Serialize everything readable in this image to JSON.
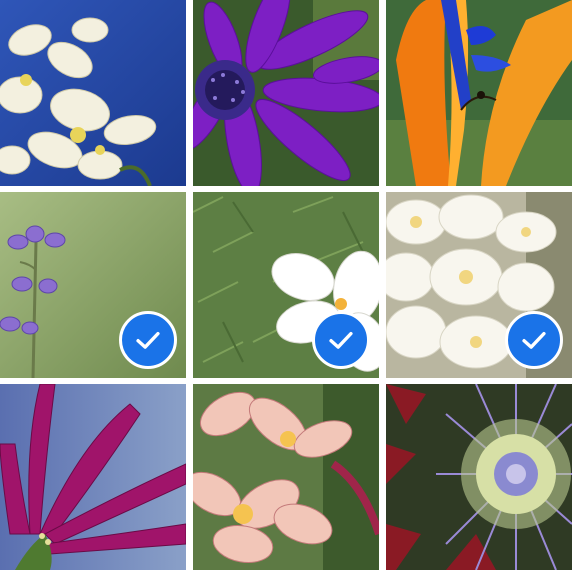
{
  "grid": {
    "photos": [
      {
        "id": "plumeria-white-blue-sky",
        "selected": false
      },
      {
        "id": "purple-daisy",
        "selected": false
      },
      {
        "id": "bird-of-paradise",
        "selected": false
      },
      {
        "id": "purple-lupine",
        "selected": true
      },
      {
        "id": "white-flower-on-grass",
        "selected": true
      },
      {
        "id": "white-plumeria-cluster",
        "selected": true
      },
      {
        "id": "magenta-petals",
        "selected": false
      },
      {
        "id": "pink-yellow-plumeria",
        "selected": false
      },
      {
        "id": "protea-flower",
        "selected": false
      }
    ]
  },
  "icons": {
    "selected_badge": "checkmark-circle-icon"
  },
  "colors": {
    "selection_blue": "#1a73e8",
    "separator": "#ffffff"
  }
}
